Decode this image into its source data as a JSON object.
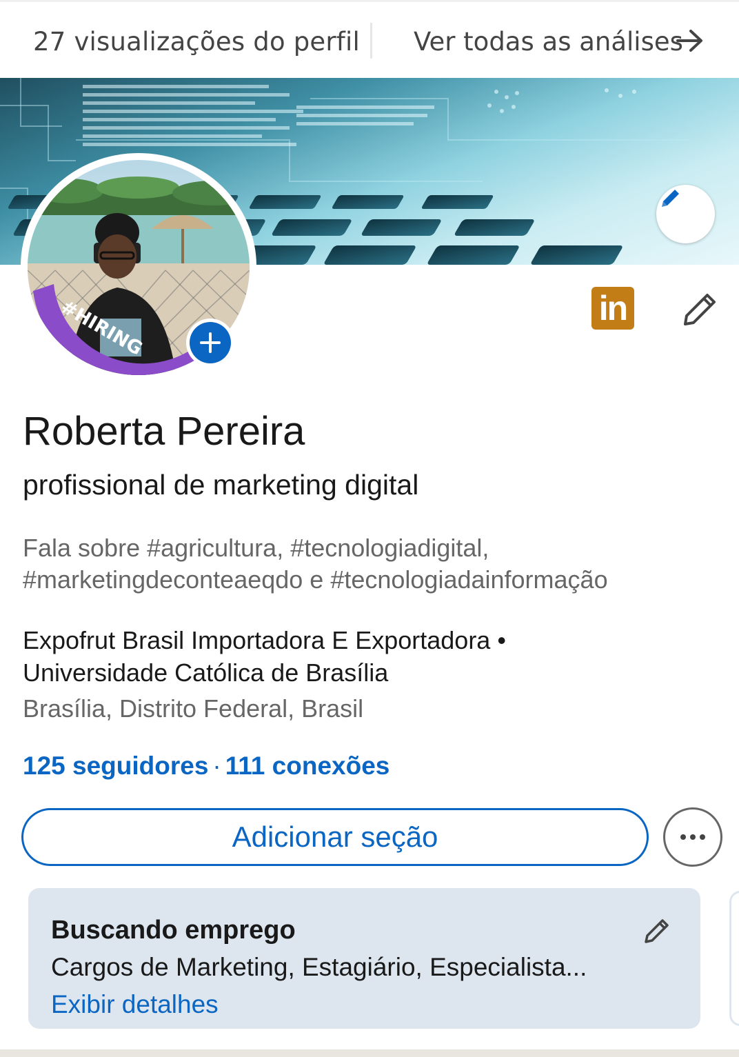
{
  "top_bar": {
    "profile_views": "27 visualizações do perfil",
    "analytics_link": "Ver todas as análises"
  },
  "profile": {
    "name": "Roberta Pereira",
    "headline": "profissional de marketing digital",
    "talks_about": "Fala sobre #agricultura, #tecnologiadigital, #marketingdeconteaeqdo e #tecnologiadainformação",
    "company_line_1": "Expofrut Brasil Importadora E Exportadora •",
    "company_line_2": "Universidade Católica de Brasília",
    "location": "Brasília, Distrito Federal, Brasil",
    "followers": "125 seguidores",
    "separator": "·",
    "connections": "111 conexões",
    "badge_text": "#HIRING",
    "linkedin_badge": "in"
  },
  "actions": {
    "add_section": "Adicionar seção"
  },
  "open_to_work_card": {
    "title": "Buscando emprego",
    "roles": "Cargos de Marketing, Estagiário, Especialista...",
    "details_link": "Exibir detalhes"
  },
  "colors": {
    "accent": "#0a66c2",
    "hiring_frame": "#8a4cc8",
    "linkedin_badge": "#c37d16",
    "card_bg": "#dde6ef"
  },
  "icons": [
    "arrow-right-icon",
    "pencil-icon",
    "plus-icon",
    "more-icon"
  ]
}
